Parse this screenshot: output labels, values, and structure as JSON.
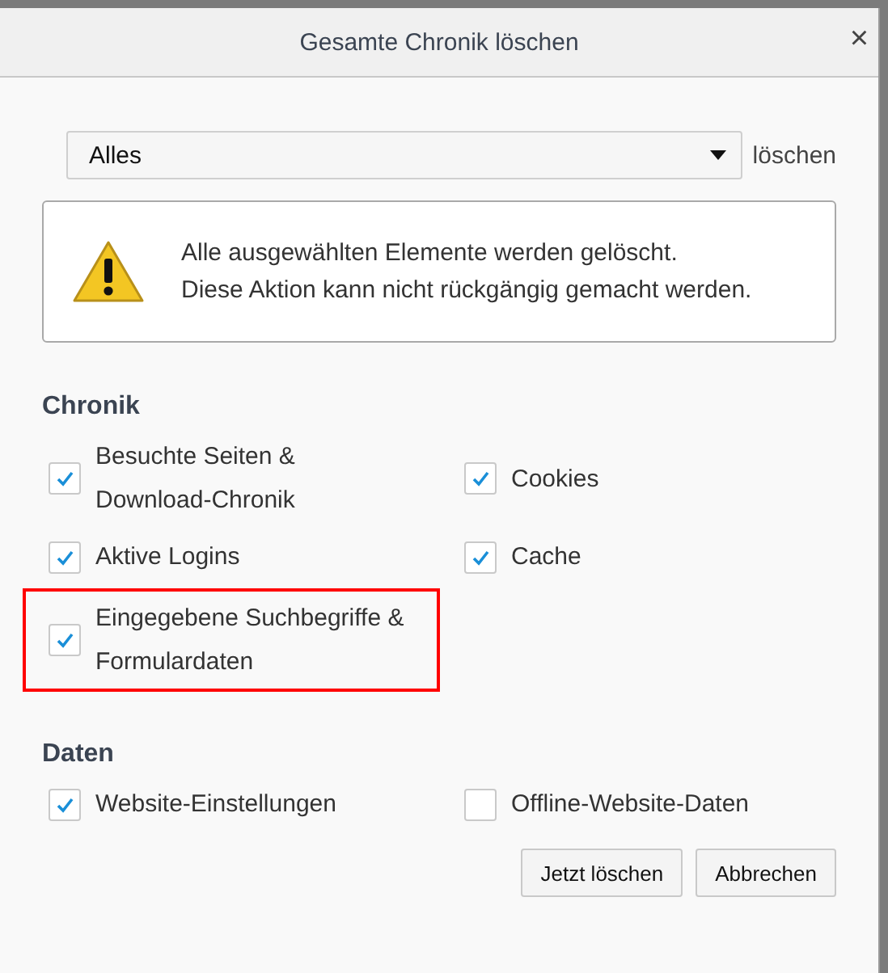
{
  "window": {
    "title": "Gesamte Chronik löschen",
    "close": "×"
  },
  "range": {
    "value": "Alles",
    "suffix": "löschen"
  },
  "warning": {
    "lines": [
      "Alle ausgewählten Elemente werden gelöscht.",
      "Diese Aktion kann nicht rückgängig gemacht werden."
    ]
  },
  "sections": [
    {
      "title": "Chronik",
      "items": [
        {
          "label": "Besuchte Seiten & Download-Chronik",
          "checked": true,
          "highlighted": false
        },
        {
          "label": "Cookies",
          "checked": true,
          "highlighted": false
        },
        {
          "label": "Aktive Logins",
          "checked": true,
          "highlighted": false
        },
        {
          "label": "Cache",
          "checked": true,
          "highlighted": false
        },
        {
          "label": "Eingegebene Suchbegriffe & Formulardaten",
          "checked": true,
          "highlighted": true
        }
      ]
    },
    {
      "title": "Daten",
      "items": [
        {
          "label": "Website-Einstellungen",
          "checked": true,
          "highlighted": false
        },
        {
          "label": "Offline-Website-Daten",
          "checked": false,
          "highlighted": false
        }
      ]
    }
  ],
  "buttons": [
    "Jetzt löschen",
    "Abbrechen"
  ]
}
